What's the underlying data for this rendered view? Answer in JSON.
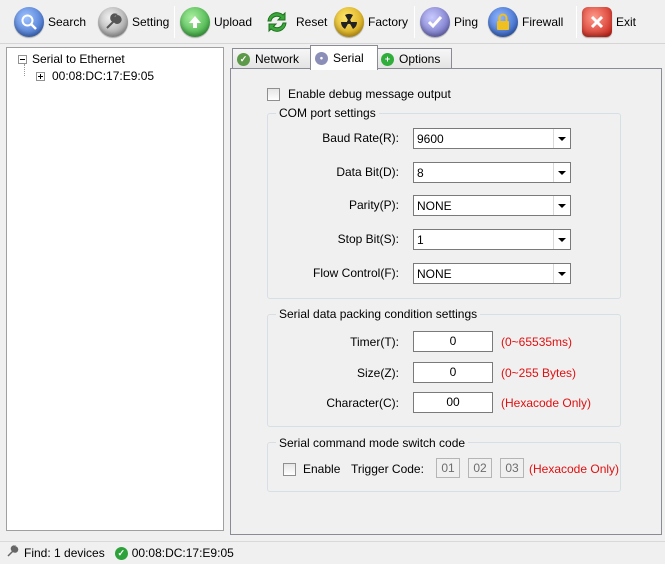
{
  "toolbar": {
    "search": "Search",
    "setting": "Setting",
    "upload": "Upload",
    "reset": "Reset",
    "factory": "Factory",
    "ping": "Ping",
    "firewall": "Firewall",
    "exit": "Exit"
  },
  "tree": {
    "root": "Serial to Ethernet",
    "device": "00:08:DC:17:E9:05"
  },
  "tabs": {
    "network": "Network",
    "serial": "Serial",
    "options": "Options"
  },
  "serial": {
    "debug_label": "Enable debug message output",
    "com": {
      "title": "COM port settings",
      "baud_label": "Baud Rate(R):",
      "baud_value": "9600",
      "databit_label": "Data Bit(D):",
      "databit_value": "8",
      "parity_label": "Parity(P):",
      "parity_value": "NONE",
      "stopbit_label": "Stop Bit(S):",
      "stopbit_value": "1",
      "flow_label": "Flow Control(F):",
      "flow_value": "NONE"
    },
    "packing": {
      "title": "Serial data packing condition settings",
      "timer_label": "Timer(T):",
      "timer_value": "0",
      "timer_hint": "(0~65535ms)",
      "size_label": "Size(Z):",
      "size_value": "0",
      "size_hint": "(0~255 Bytes)",
      "char_label": "Character(C):",
      "char_value": "00",
      "char_hint": "(Hexacode Only)"
    },
    "cmdmode": {
      "title": "Serial command mode switch code",
      "enable_label": "Enable",
      "trigger_label": "Trigger Code:",
      "code1": "01",
      "code2": "02",
      "code3": "03",
      "hint": "(Hexacode Only)"
    }
  },
  "status": {
    "find": "Find: 1 devices",
    "device": "00:08:DC:17:E9:05"
  },
  "colors": {
    "hint": "#e01010",
    "search_icon": "#3b6fd1",
    "upload_icon": "#34a83a",
    "factory_icon": "#e0b000",
    "exit_icon": "#d9291e"
  }
}
